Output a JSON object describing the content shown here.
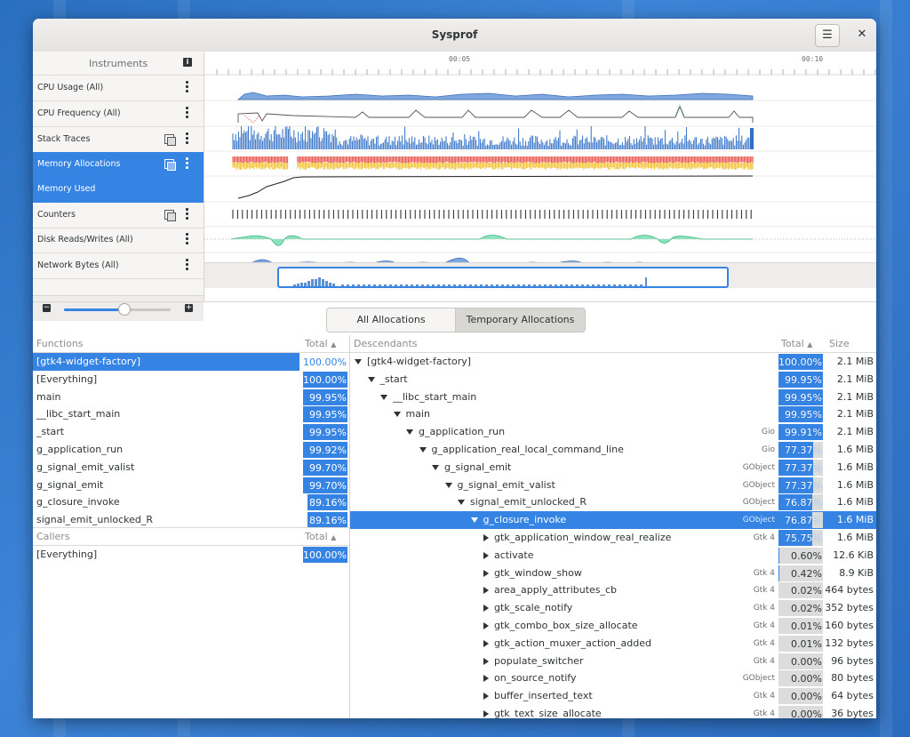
{
  "window": {
    "title": "Sysprof"
  },
  "instruments": {
    "header": "Instruments",
    "rows": [
      {
        "label": "CPU Usage (All)"
      },
      {
        "label": "CPU Frequency (All)"
      },
      {
        "label": "Stack Traces"
      },
      {
        "label": "Memory Allocations"
      },
      {
        "label": "Memory Used"
      },
      {
        "label": "Counters"
      },
      {
        "label": "Disk Reads/Writes (All)"
      },
      {
        "label": "Network Bytes (All)"
      }
    ]
  },
  "timeline": {
    "ticks": [
      "00:05",
      "00:10"
    ]
  },
  "tabs": {
    "all": "All Allocations",
    "temporary": "Temporary Allocations",
    "active": "temporary"
  },
  "functions": {
    "header": "Functions",
    "total_header": "Total",
    "rows": [
      {
        "name": "[gtk4-widget-factory]",
        "pct": "100.00%",
        "value": 100.0,
        "selected": true
      },
      {
        "name": "[Everything]",
        "pct": "100.00%",
        "value": 100.0
      },
      {
        "name": "main",
        "pct": "99.95%",
        "value": 99.95
      },
      {
        "name": "__libc_start_main",
        "pct": "99.95%",
        "value": 99.95
      },
      {
        "name": "_start",
        "pct": "99.95%",
        "value": 99.95
      },
      {
        "name": "g_application_run",
        "pct": "99.92%",
        "value": 99.92
      },
      {
        "name": "g_signal_emit_valist",
        "pct": "99.70%",
        "value": 99.7
      },
      {
        "name": "g_signal_emit",
        "pct": "99.70%",
        "value": 99.7
      },
      {
        "name": "g_closure_invoke",
        "pct": "89.16%",
        "value": 89.16
      },
      {
        "name": "signal_emit_unlocked_R",
        "pct": "89.16%",
        "value": 89.16
      }
    ]
  },
  "callers": {
    "header": "Callers",
    "total_header": "Total",
    "rows": [
      {
        "name": "[Everything]",
        "pct": "100.00%",
        "value": 100.0
      }
    ]
  },
  "descendants": {
    "header": "Descendants",
    "total_header": "Total",
    "size_header": "Size",
    "rows": [
      {
        "name": "[gtk4-widget-factory]",
        "depth": 0,
        "expanded": true,
        "tag": "",
        "pct": "100.00%",
        "value": 100.0,
        "size": "2.1 MiB"
      },
      {
        "name": "_start",
        "depth": 1,
        "expanded": true,
        "tag": "",
        "pct": "99.95%",
        "value": 99.95,
        "size": "2.1 MiB"
      },
      {
        "name": "__libc_start_main",
        "depth": 2,
        "expanded": true,
        "tag": "",
        "pct": "99.95%",
        "value": 99.95,
        "size": "2.1 MiB"
      },
      {
        "name": "main",
        "depth": 3,
        "expanded": true,
        "tag": "",
        "pct": "99.95%",
        "value": 99.95,
        "size": "2.1 MiB"
      },
      {
        "name": "g_application_run",
        "depth": 4,
        "expanded": true,
        "tag": "Gio",
        "pct": "99.91%",
        "value": 99.91,
        "size": "2.1 MiB"
      },
      {
        "name": "g_application_real_local_command_line",
        "depth": 5,
        "expanded": true,
        "tag": "Gio",
        "pct": "77.37%",
        "value": 77.37,
        "size": "1.6 MiB"
      },
      {
        "name": "g_signal_emit",
        "depth": 6,
        "expanded": true,
        "tag": "GObject",
        "pct": "77.37%",
        "value": 77.37,
        "size": "1.6 MiB"
      },
      {
        "name": "g_signal_emit_valist",
        "depth": 7,
        "expanded": true,
        "tag": "GObject",
        "pct": "77.37%",
        "value": 77.37,
        "size": "1.6 MiB"
      },
      {
        "name": "signal_emit_unlocked_R",
        "depth": 8,
        "expanded": true,
        "tag": "GObject",
        "pct": "76.87%",
        "value": 76.87,
        "size": "1.6 MiB"
      },
      {
        "name": "g_closure_invoke",
        "depth": 9,
        "expanded": true,
        "tag": "GObject",
        "pct": "76.87%",
        "value": 76.87,
        "size": "1.6 MiB",
        "selected": true
      },
      {
        "name": "gtk_application_window_real_realize",
        "depth": 10,
        "expanded": false,
        "tag": "Gtk 4",
        "pct": "75.75%",
        "value": 75.75,
        "size": "1.6 MiB"
      },
      {
        "name": "activate",
        "depth": 10,
        "expanded": false,
        "tag": "",
        "pct": "0.60%",
        "value": 0.6,
        "size": "12.6 KiB"
      },
      {
        "name": "gtk_window_show",
        "depth": 10,
        "expanded": false,
        "tag": "Gtk 4",
        "pct": "0.42%",
        "value": 0.42,
        "size": "8.9 KiB"
      },
      {
        "name": "area_apply_attributes_cb",
        "depth": 10,
        "expanded": false,
        "tag": "Gtk 4",
        "pct": "0.02%",
        "value": 0.02,
        "size": "464 bytes"
      },
      {
        "name": "gtk_scale_notify",
        "depth": 10,
        "expanded": false,
        "tag": "Gtk 4",
        "pct": "0.02%",
        "value": 0.02,
        "size": "352 bytes"
      },
      {
        "name": "gtk_combo_box_size_allocate",
        "depth": 10,
        "expanded": false,
        "tag": "Gtk 4",
        "pct": "0.01%",
        "value": 0.01,
        "size": "160 bytes"
      },
      {
        "name": "gtk_action_muxer_action_added",
        "depth": 10,
        "expanded": false,
        "tag": "Gtk 4",
        "pct": "0.01%",
        "value": 0.01,
        "size": "132 bytes"
      },
      {
        "name": "populate_switcher",
        "depth": 10,
        "expanded": false,
        "tag": "Gtk 4",
        "pct": "0.00%",
        "value": 0.0,
        "size": "96 bytes"
      },
      {
        "name": "on_source_notify",
        "depth": 10,
        "expanded": false,
        "tag": "GObject",
        "pct": "0.00%",
        "value": 0.0,
        "size": "80 bytes"
      },
      {
        "name": "buffer_inserted_text",
        "depth": 10,
        "expanded": false,
        "tag": "Gtk 4",
        "pct": "0.00%",
        "value": 0.0,
        "size": "64 bytes"
      },
      {
        "name": "gtk_text_size_allocate",
        "depth": 10,
        "expanded": false,
        "tag": "Gtk 4",
        "pct": "0.00%",
        "value": 0.0,
        "size": "36 bytes"
      }
    ]
  },
  "colors": {
    "accent": "#3584e4",
    "cpu": "#5b8fd2",
    "disk": "#5ad2a0",
    "alloc_red": "#e8504a",
    "alloc_yellow": "#f2c12e"
  }
}
